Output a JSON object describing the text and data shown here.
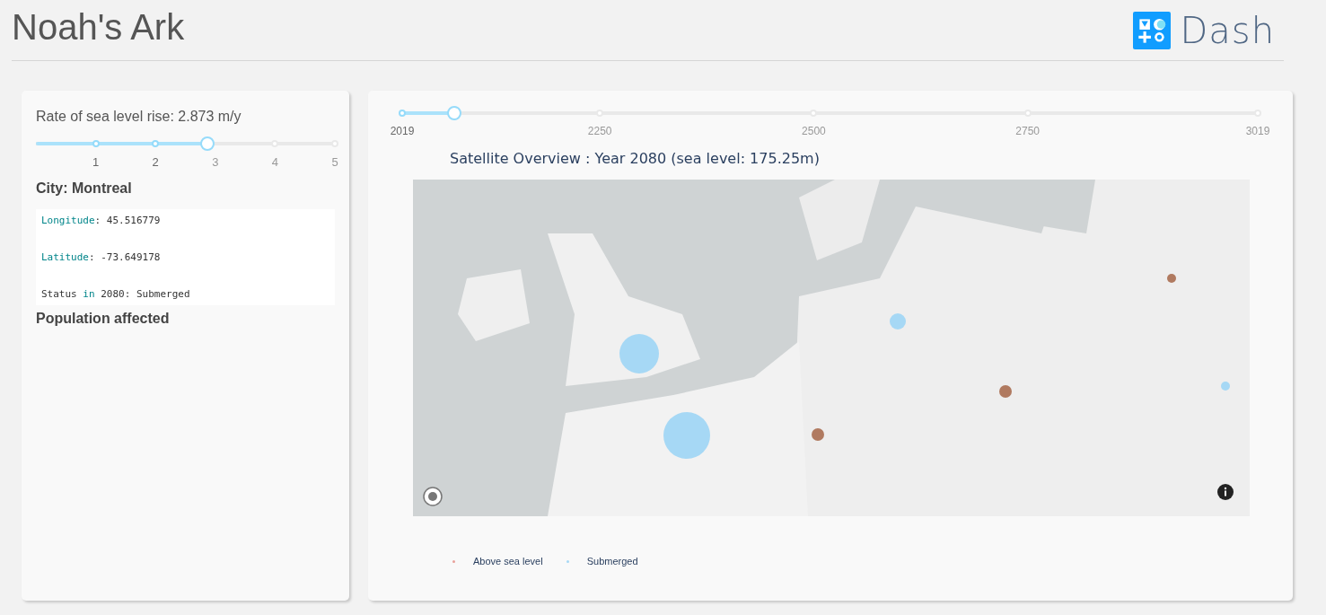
{
  "header": {
    "title": "Noah's Ark",
    "logo_text": "Dash"
  },
  "rate_panel": {
    "label": "Rate of sea level rise: 2.873 m/y",
    "slider": {
      "level": 0.5746,
      "marks": [
        "1",
        "2",
        "3",
        "4",
        "5"
      ]
    },
    "city": "City: Montreal",
    "code_lines": [
      {
        "parts": [
          {
            "text": "Longitude",
            "kind": "keyword"
          },
          {
            "text": ": 45.516779",
            "kind": "plain"
          }
        ]
      },
      {
        "parts": [
          {
            "text": "Latitude",
            "kind": "keyword"
          },
          {
            "text": ": -73.649178",
            "kind": "plain"
          }
        ]
      },
      {
        "parts": [
          {
            "text": "Status ",
            "kind": "plain"
          },
          {
            "text": "in",
            "kind": "keyword"
          },
          {
            "text": " 2080: Submerged",
            "kind": "plain"
          }
        ]
      }
    ],
    "population_heading": "Population affected"
  },
  "map_panel": {
    "year_slider": {
      "level": 0.061,
      "marks": [
        {
          "label": "2019",
          "level": 0
        },
        {
          "label": "2250",
          "level": 0.231
        },
        {
          "label": "2500",
          "level": 0.481
        },
        {
          "label": "2750",
          "level": 0.731
        },
        {
          "label": "3019",
          "level": 1
        }
      ]
    },
    "title": "Satellite Overview : Year 2080 (sea level: 175.25m)",
    "legend": [
      {
        "label": "Above sea level",
        "color": "#e8a09a"
      },
      {
        "label": "Submerged",
        "color": "#a6d8f5"
      }
    ]
  }
}
